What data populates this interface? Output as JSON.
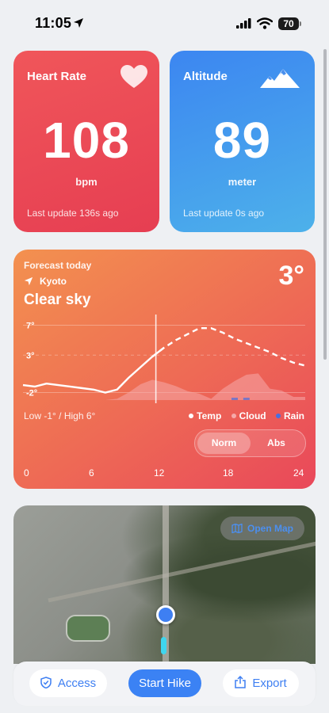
{
  "status": {
    "time": "11:05",
    "battery": "70"
  },
  "heart_rate": {
    "title": "Heart Rate",
    "value": "108",
    "unit": "bpm",
    "updated": "Last update 136s ago"
  },
  "altitude": {
    "title": "Altitude",
    "value": "89",
    "unit": "meter",
    "updated": "Last update 0s ago"
  },
  "weather": {
    "subtitle": "Forecast today",
    "location": "Kyoto",
    "condition": "Clear sky",
    "current_temp": "3°",
    "low_high": "Low -1° / High 6°",
    "legend": [
      {
        "label": "Temp",
        "color": "#ffffff"
      },
      {
        "label": "Cloud",
        "color": "#f6a9a9"
      },
      {
        "label": "Rain",
        "color": "#4a6fe0"
      }
    ],
    "toggle": {
      "norm": "Norm",
      "abs": "Abs"
    },
    "hour_labels": [
      "0",
      "6",
      "12",
      "18",
      "24"
    ]
  },
  "chart_data": {
    "type": "line",
    "x_ticks": [
      0,
      6,
      12,
      18,
      24
    ],
    "y_ticks": [
      "7°",
      "3°",
      "-2°"
    ],
    "ylim": [
      -3,
      8
    ],
    "now_hour": 11.3,
    "series": [
      {
        "name": "Temp",
        "x": [
          0,
          1,
          2,
          3,
          4,
          5,
          6,
          7,
          8,
          9,
          10,
          11,
          12,
          13,
          14,
          15,
          16,
          17,
          18,
          19,
          20,
          21,
          22,
          23,
          24
        ],
        "values": [
          -1,
          -1.2,
          -0.8,
          -1,
          -1.2,
          -1.4,
          -1.6,
          -2,
          -1.6,
          0,
          1.4,
          2.8,
          4,
          5,
          5.8,
          6.6,
          6.6,
          6,
          5.2,
          4.6,
          4,
          3.4,
          2.6,
          2,
          1.6
        ]
      },
      {
        "name": "Cloud",
        "x": [
          0,
          1,
          2,
          3,
          4,
          5,
          6,
          7,
          8,
          9,
          10,
          11,
          12,
          13,
          14,
          15,
          16,
          17,
          18,
          19,
          20,
          21,
          22,
          23,
          24
        ],
        "values": [
          0,
          0,
          0,
          0,
          0,
          0,
          0,
          0,
          2,
          12,
          25,
          32,
          28,
          22,
          14,
          10,
          2,
          18,
          30,
          40,
          42,
          18,
          15,
          5,
          5
        ]
      },
      {
        "name": "Rain",
        "x": [
          0,
          1,
          2,
          3,
          4,
          5,
          6,
          7,
          8,
          9,
          10,
          11,
          12,
          13,
          14,
          15,
          16,
          17,
          18,
          19,
          20,
          21,
          22,
          23,
          24
        ],
        "values": [
          0,
          0,
          0,
          0,
          0,
          0,
          0,
          0,
          0,
          0,
          0,
          0,
          0,
          0,
          0,
          0,
          0,
          0,
          1,
          1,
          0,
          0,
          0,
          0,
          0
        ]
      }
    ]
  },
  "map": {
    "open_label": "Open Map"
  },
  "bottom": {
    "access": "Access",
    "start": "Start Hike",
    "export": "Export"
  }
}
